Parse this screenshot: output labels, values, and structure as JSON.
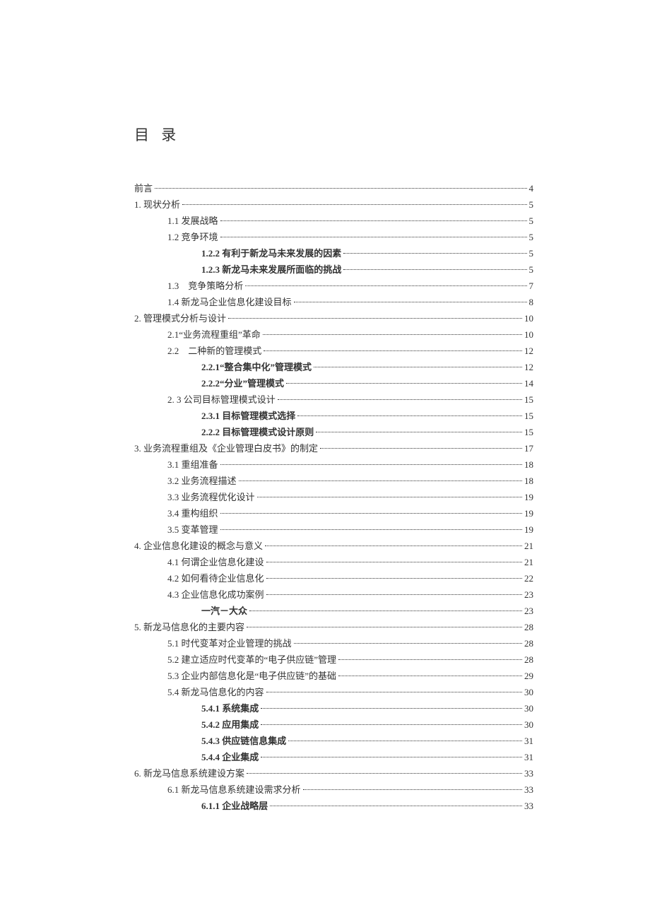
{
  "title": "目 录",
  "toc": [
    {
      "label": "前言",
      "page": "4",
      "indent": 0,
      "bold": false
    },
    {
      "label": "1. 现状分析",
      "page": "5",
      "indent": 0,
      "bold": false
    },
    {
      "label": "1.1 发展战略",
      "page": "5",
      "indent": 1,
      "bold": false
    },
    {
      "label": "1.2 竞争环境",
      "page": "5",
      "indent": 1,
      "bold": false
    },
    {
      "label": "1.2.2 有利于新龙马未来发展的因素 ",
      "page": "5",
      "indent": 2,
      "bold": true
    },
    {
      "label": "1.2.3 新龙马未来发展所面临的挑战 ",
      "page": "5",
      "indent": 2,
      "bold": true
    },
    {
      "label": "1.3　竞争策略分析",
      "page": "7",
      "indent": 1,
      "bold": false
    },
    {
      "label": "1.4 新龙马企业信息化建设目标",
      "page": "8",
      "indent": 1,
      "bold": false
    },
    {
      "label": "2. 管理模式分析与设计",
      "page": "10",
      "indent": 0,
      "bold": false
    },
    {
      "label": "2.1“业务流程重组”革命",
      "page": "10",
      "indent": 1,
      "bold": false
    },
    {
      "label": "2.2　二种新的管理模式",
      "page": "12",
      "indent": 1,
      "bold": false
    },
    {
      "label": "2.2.1“整合集中化”管理模式 ",
      "page": "12",
      "indent": 2,
      "bold": true
    },
    {
      "label": "2.2.2“分业”管理模式 ",
      "page": "14",
      "indent": 2,
      "bold": true
    },
    {
      "label": "2. 3 公司目标管理模式设计",
      "page": "15",
      "indent": 1,
      "bold": false
    },
    {
      "label": "2.3.1 目标管理模式选择 ",
      "page": "15",
      "indent": 2,
      "bold": true
    },
    {
      "label": "2.2.2 目标管理模式设计原则 ",
      "page": "15",
      "indent": 2,
      "bold": true
    },
    {
      "label": "3. 业务流程重组及《企业管理白皮书》的制定",
      "page": "17",
      "indent": 0,
      "bold": false
    },
    {
      "label": "3.1 重组准备",
      "page": "18",
      "indent": 1,
      "bold": false
    },
    {
      "label": "3.2 业务流程描述",
      "page": "18",
      "indent": 1,
      "bold": false
    },
    {
      "label": "3.3 业务流程优化设计",
      "page": "19",
      "indent": 1,
      "bold": false
    },
    {
      "label": "3.4 重构组织",
      "page": "19",
      "indent": 1,
      "bold": false
    },
    {
      "label": "3.5 变革管理",
      "page": "19",
      "indent": 1,
      "bold": false
    },
    {
      "label": "4. 企业信息化建设的概念与意义",
      "page": "21",
      "indent": 0,
      "bold": false
    },
    {
      "label": "4.1 何谓企业信息化建设",
      "page": "21",
      "indent": 1,
      "bold": false
    },
    {
      "label": "4.2 如何看待企业信息化",
      "page": "22",
      "indent": 1,
      "bold": false
    },
    {
      "label": "4.3 企业信息化成功案例",
      "page": "23",
      "indent": 1,
      "bold": false
    },
    {
      "label": "一汽－大众 ",
      "page": "23",
      "indent": 2,
      "bold": true
    },
    {
      "label": "5. 新龙马信息化的主要内容",
      "page": "28",
      "indent": 0,
      "bold": false
    },
    {
      "label": "5.1 时代变革对企业管理的挑战",
      "page": "28",
      "indent": 1,
      "bold": false
    },
    {
      "label": "5.2 建立适应时代变革的“电子供应链”管理",
      "page": "28",
      "indent": 1,
      "bold": false
    },
    {
      "label": "5.3 企业内部信息化是“电子供应链”的基础",
      "page": "29",
      "indent": 1,
      "bold": false
    },
    {
      "label": "5.4 新龙马信息化的内容",
      "page": "30",
      "indent": 1,
      "bold": false
    },
    {
      "label": "5.4.1 系统集成 ",
      "page": "30",
      "indent": 2,
      "bold": true
    },
    {
      "label": "5.4.2 应用集成 ",
      "page": "30",
      "indent": 2,
      "bold": true
    },
    {
      "label": "5.4.3 供应链信息集成 ",
      "page": "31",
      "indent": 2,
      "bold": true
    },
    {
      "label": "5.4.4 企业集成 ",
      "page": "31",
      "indent": 2,
      "bold": true
    },
    {
      "label": "6. 新龙马信息系统建设方案",
      "page": "33",
      "indent": 0,
      "bold": false
    },
    {
      "label": "6.1 新龙马信息系统建设需求分析",
      "page": "33",
      "indent": 1,
      "bold": false
    },
    {
      "label": "6.1.1 企业战略层 ",
      "page": "33",
      "indent": 2,
      "bold": true
    }
  ]
}
